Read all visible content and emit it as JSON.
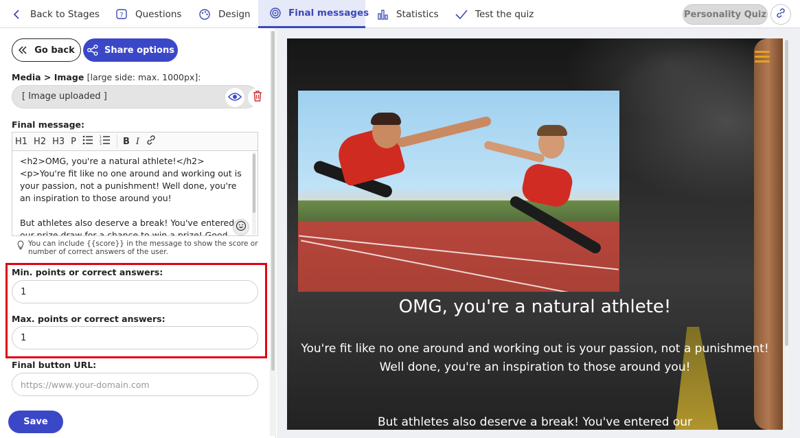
{
  "nav": {
    "back": "Back to Stages",
    "questions": "Questions",
    "design": "Design",
    "final_messages": "Final messages",
    "statistics": "Statistics",
    "test_quiz": "Test the quiz",
    "quiz_type": "Personality Quiz"
  },
  "left": {
    "go_back": "Go back",
    "share_options": "Share options",
    "media_label": "Media > Image",
    "media_sub": "[large side: max. 1000px]:",
    "media_value": "[ Image uploaded ]",
    "final_message_label": "Final message:",
    "toolbar": {
      "h1": "H1",
      "h2": "H2",
      "h3": "H3",
      "p": "P",
      "bold": "B",
      "italic": "I"
    },
    "editor_content": "<h2>OMG, you're a natural athlete!</h2>\n<p>You're fit like no one around and working out is your passion, not a punishment! Well done, you're an inspiration to those around you!\n\nBut athletes also deserve a break! You've entered our prize draw for a chance to win a prize! Good luck!</p>",
    "hint": "You can include {{score}} in the message to show the score or number of correct answers of the user.",
    "min_label": "Min. points or correct answers:",
    "min_value": "1",
    "max_label": "Max. points or correct answers:",
    "max_value": "1",
    "button_url_label": "Final button URL:",
    "button_url_placeholder": "https://www.your-domain.com",
    "save": "Save"
  },
  "preview": {
    "title": "OMG, you're a natural athlete!",
    "body": "You're fit like no one around and working out is your passion, not a punishment! Well done, you're an inspiration to those around you!",
    "body2": "But athletes also deserve a break! You've entered our"
  },
  "colors": {
    "accent": "#3a48c8",
    "highlight": "#e00010",
    "menu_icon": "#e8a21c"
  }
}
